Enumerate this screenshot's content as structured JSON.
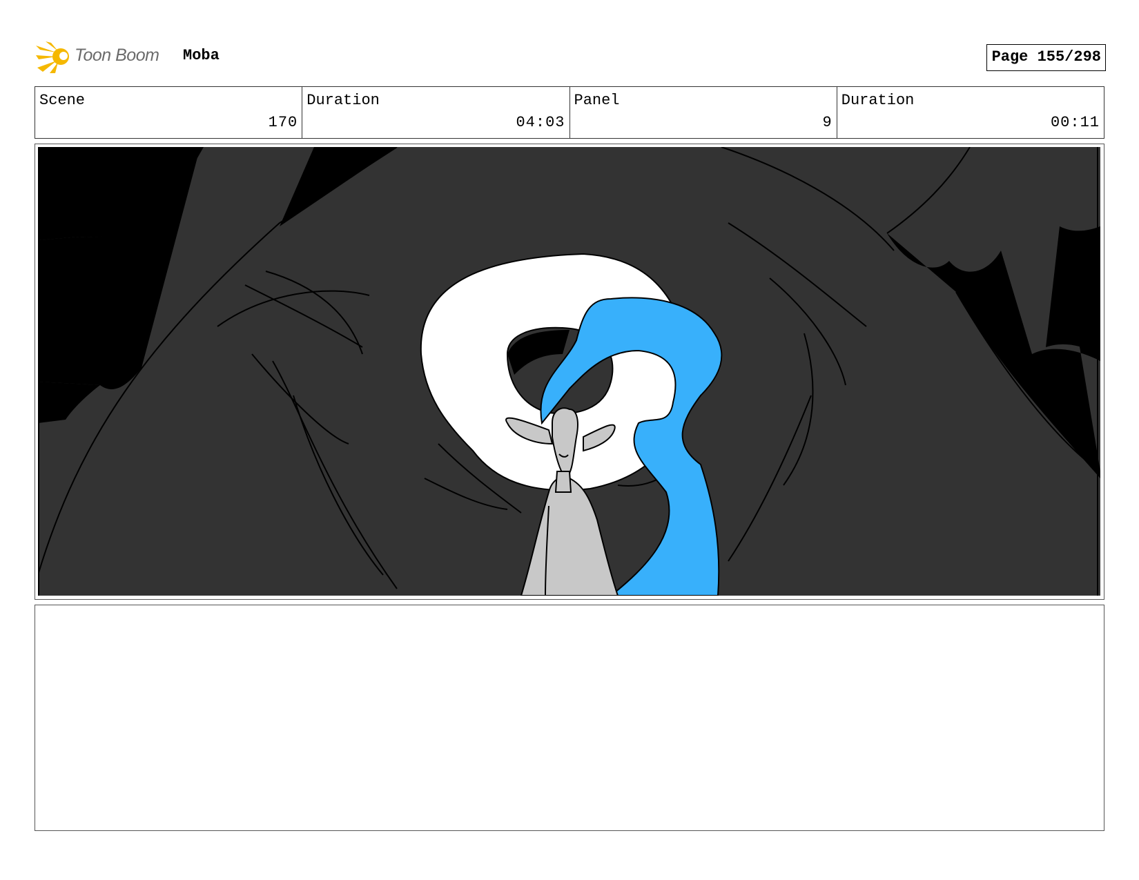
{
  "header": {
    "brand": "Toon Boom",
    "project": "Moba",
    "page": "Page 155/298"
  },
  "info": {
    "scene_label": "Scene",
    "scene_value": "170",
    "duration_label": "Duration",
    "duration_value": "04:03",
    "panel_label": "Panel",
    "panel_value": "9",
    "panel_duration_label": "Duration",
    "panel_duration_value": "00:11"
  },
  "colors": {
    "background": "#333333",
    "silhouette": "#000000",
    "moon": "#ffffff",
    "hair": "#38b0fb",
    "figure": "#c8c8c8",
    "logo": "#f5b800"
  }
}
